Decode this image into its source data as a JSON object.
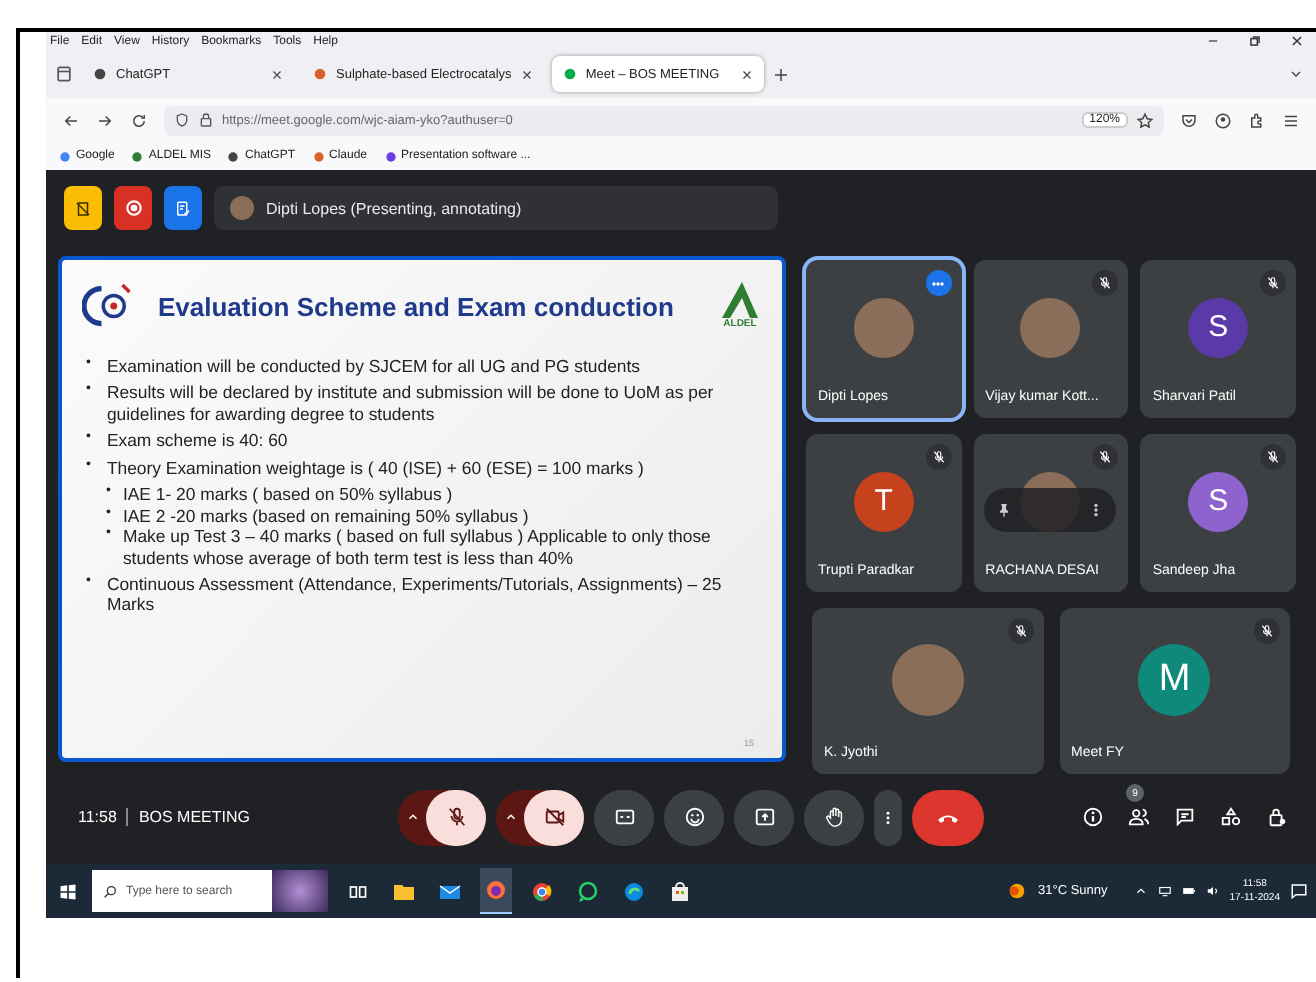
{
  "menu_bar": [
    "File",
    "Edit",
    "View",
    "History",
    "Bookmarks",
    "Tools",
    "Help"
  ],
  "tabs": [
    {
      "label": "ChatGPT",
      "selected": false
    },
    {
      "label": "Sulphate-based Electrocatalys",
      "selected": false
    },
    {
      "label": "Meet – BOS MEETING",
      "selected": true
    }
  ],
  "address_bar": {
    "url": "https://meet.google.com/wjc-aiam-yko?authuser=0",
    "zoom": "120%"
  },
  "bookmarks": [
    "Google",
    "ALDEL MIS",
    "ChatGPT",
    "Claude",
    "Presentation software ..."
  ],
  "meet": {
    "presenter": "Dipti Lopes (Presenting, annotating)",
    "slide": {
      "title": "Evaluation Scheme and Exam conduction",
      "logo_text": "ALDEL",
      "page_number": "15",
      "bullets": [
        {
          "marker": "•",
          "text": "Examination will be conducted by SJCEM for all UG and PG students"
        },
        {
          "marker": "•",
          "text": "Results will be declared by institute and submission will be done to UoM as per guidelines for awarding degree to students"
        },
        {
          "marker": "•",
          "text": "Exam scheme is 40: 60"
        },
        {
          "marker": "•",
          "text": "Theory Examination weightage is ( 40 (ISE) +  60 (ESE) = 100 marks )",
          "children": [
            {
              "marker": "•",
              "text": "IAE 1- 20 marks ( based on 50% syllabus )"
            },
            {
              "marker": "•",
              "text": "IAE 2 -20 marks  (based on remaining 50% syllabus )"
            },
            {
              "marker": "•",
              "text": "Make up Test 3 – 40 marks  ( based on full syllabus ) Applicable to only those students whose average of both term test is less than 40%"
            }
          ]
        },
        {
          "marker": "•",
          "text": "Continuous Assessment (Attendance, Experiments/Tutorials, Assignments) – 25 Marks"
        }
      ]
    },
    "participants": [
      {
        "name": "Dipti Lopes",
        "kind": "photo",
        "muted": false,
        "selected": true,
        "hovered": false
      },
      {
        "name": "Vijay kumar Kott...",
        "kind": "photo",
        "muted": true,
        "selected": false,
        "hovered": false
      },
      {
        "name": "Sharvari Patil",
        "kind": "initial",
        "initial": "S",
        "color": "#5b3aa8",
        "muted": true,
        "selected": false,
        "hovered": false
      },
      {
        "name": "Trupti Paradkar",
        "kind": "initial",
        "initial": "T",
        "color": "#c5421c",
        "muted": true,
        "selected": false,
        "hovered": false
      },
      {
        "name": "RACHANA DESAI",
        "kind": "photo",
        "muted": true,
        "selected": false,
        "hovered": true
      },
      {
        "name": "Sandeep Jha",
        "kind": "initial",
        "initial": "S",
        "color": "#8e63ce",
        "muted": true,
        "selected": false,
        "hovered": false
      },
      {
        "name": "K. Jyothi",
        "kind": "photo",
        "muted": true,
        "selected": false,
        "hovered": false
      },
      {
        "name": "Meet FY",
        "kind": "initial",
        "initial": "M",
        "color": "#0f8a7a",
        "muted": true,
        "selected": false,
        "hovered": false
      }
    ],
    "time": "11:58",
    "meeting_title": "BOS MEETING",
    "people_count": "9",
    "mic_on": false,
    "camera_on": false
  },
  "taskbar": {
    "search_placeholder": "Type here to search",
    "weather": "31°C Sunny",
    "time": "11:58",
    "date": "17-11-2024"
  }
}
